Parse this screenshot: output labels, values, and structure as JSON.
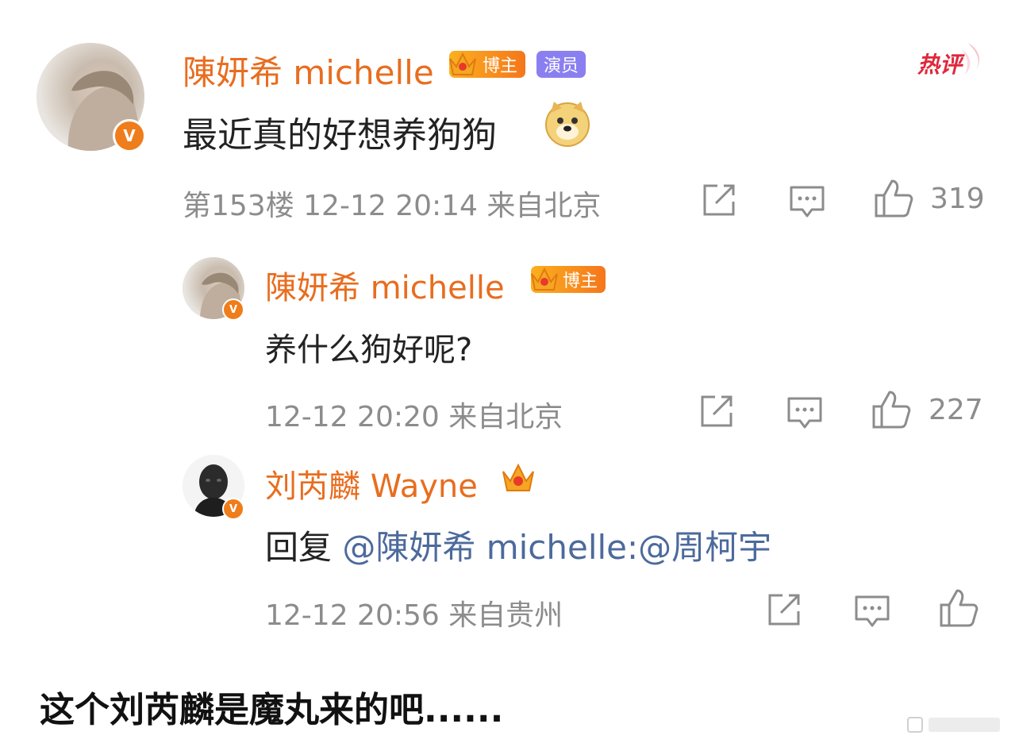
{
  "hot_label": "热评",
  "comment": {
    "author": "陳妍希 michelle",
    "tag_blogger": "博主",
    "tag_actor": "演员",
    "text": "最近真的好想养狗狗",
    "meta": "第153楼 12-12 20:14 来自北京",
    "likes": "319"
  },
  "replies": [
    {
      "author": "陳妍希 michelle",
      "tag_blogger": "博主",
      "text": "养什么狗好呢?",
      "meta": "12-12 20:20 来自北京",
      "likes": "227"
    },
    {
      "author": "刘芮麟 Wayne",
      "reply_prefix": "回复 ",
      "reply_mention": "@陳妍希 michelle:@周柯宇",
      "meta": "12-12 20:56 来自贵州",
      "likes": ""
    }
  ],
  "caption": "这个刘芮麟是魔丸来的吧......",
  "verified_badge": "V",
  "colors": {
    "name": "#e86d1f",
    "meta": "#8c8c8c",
    "mention": "#4c6a9c",
    "hot": "#e0283c"
  }
}
